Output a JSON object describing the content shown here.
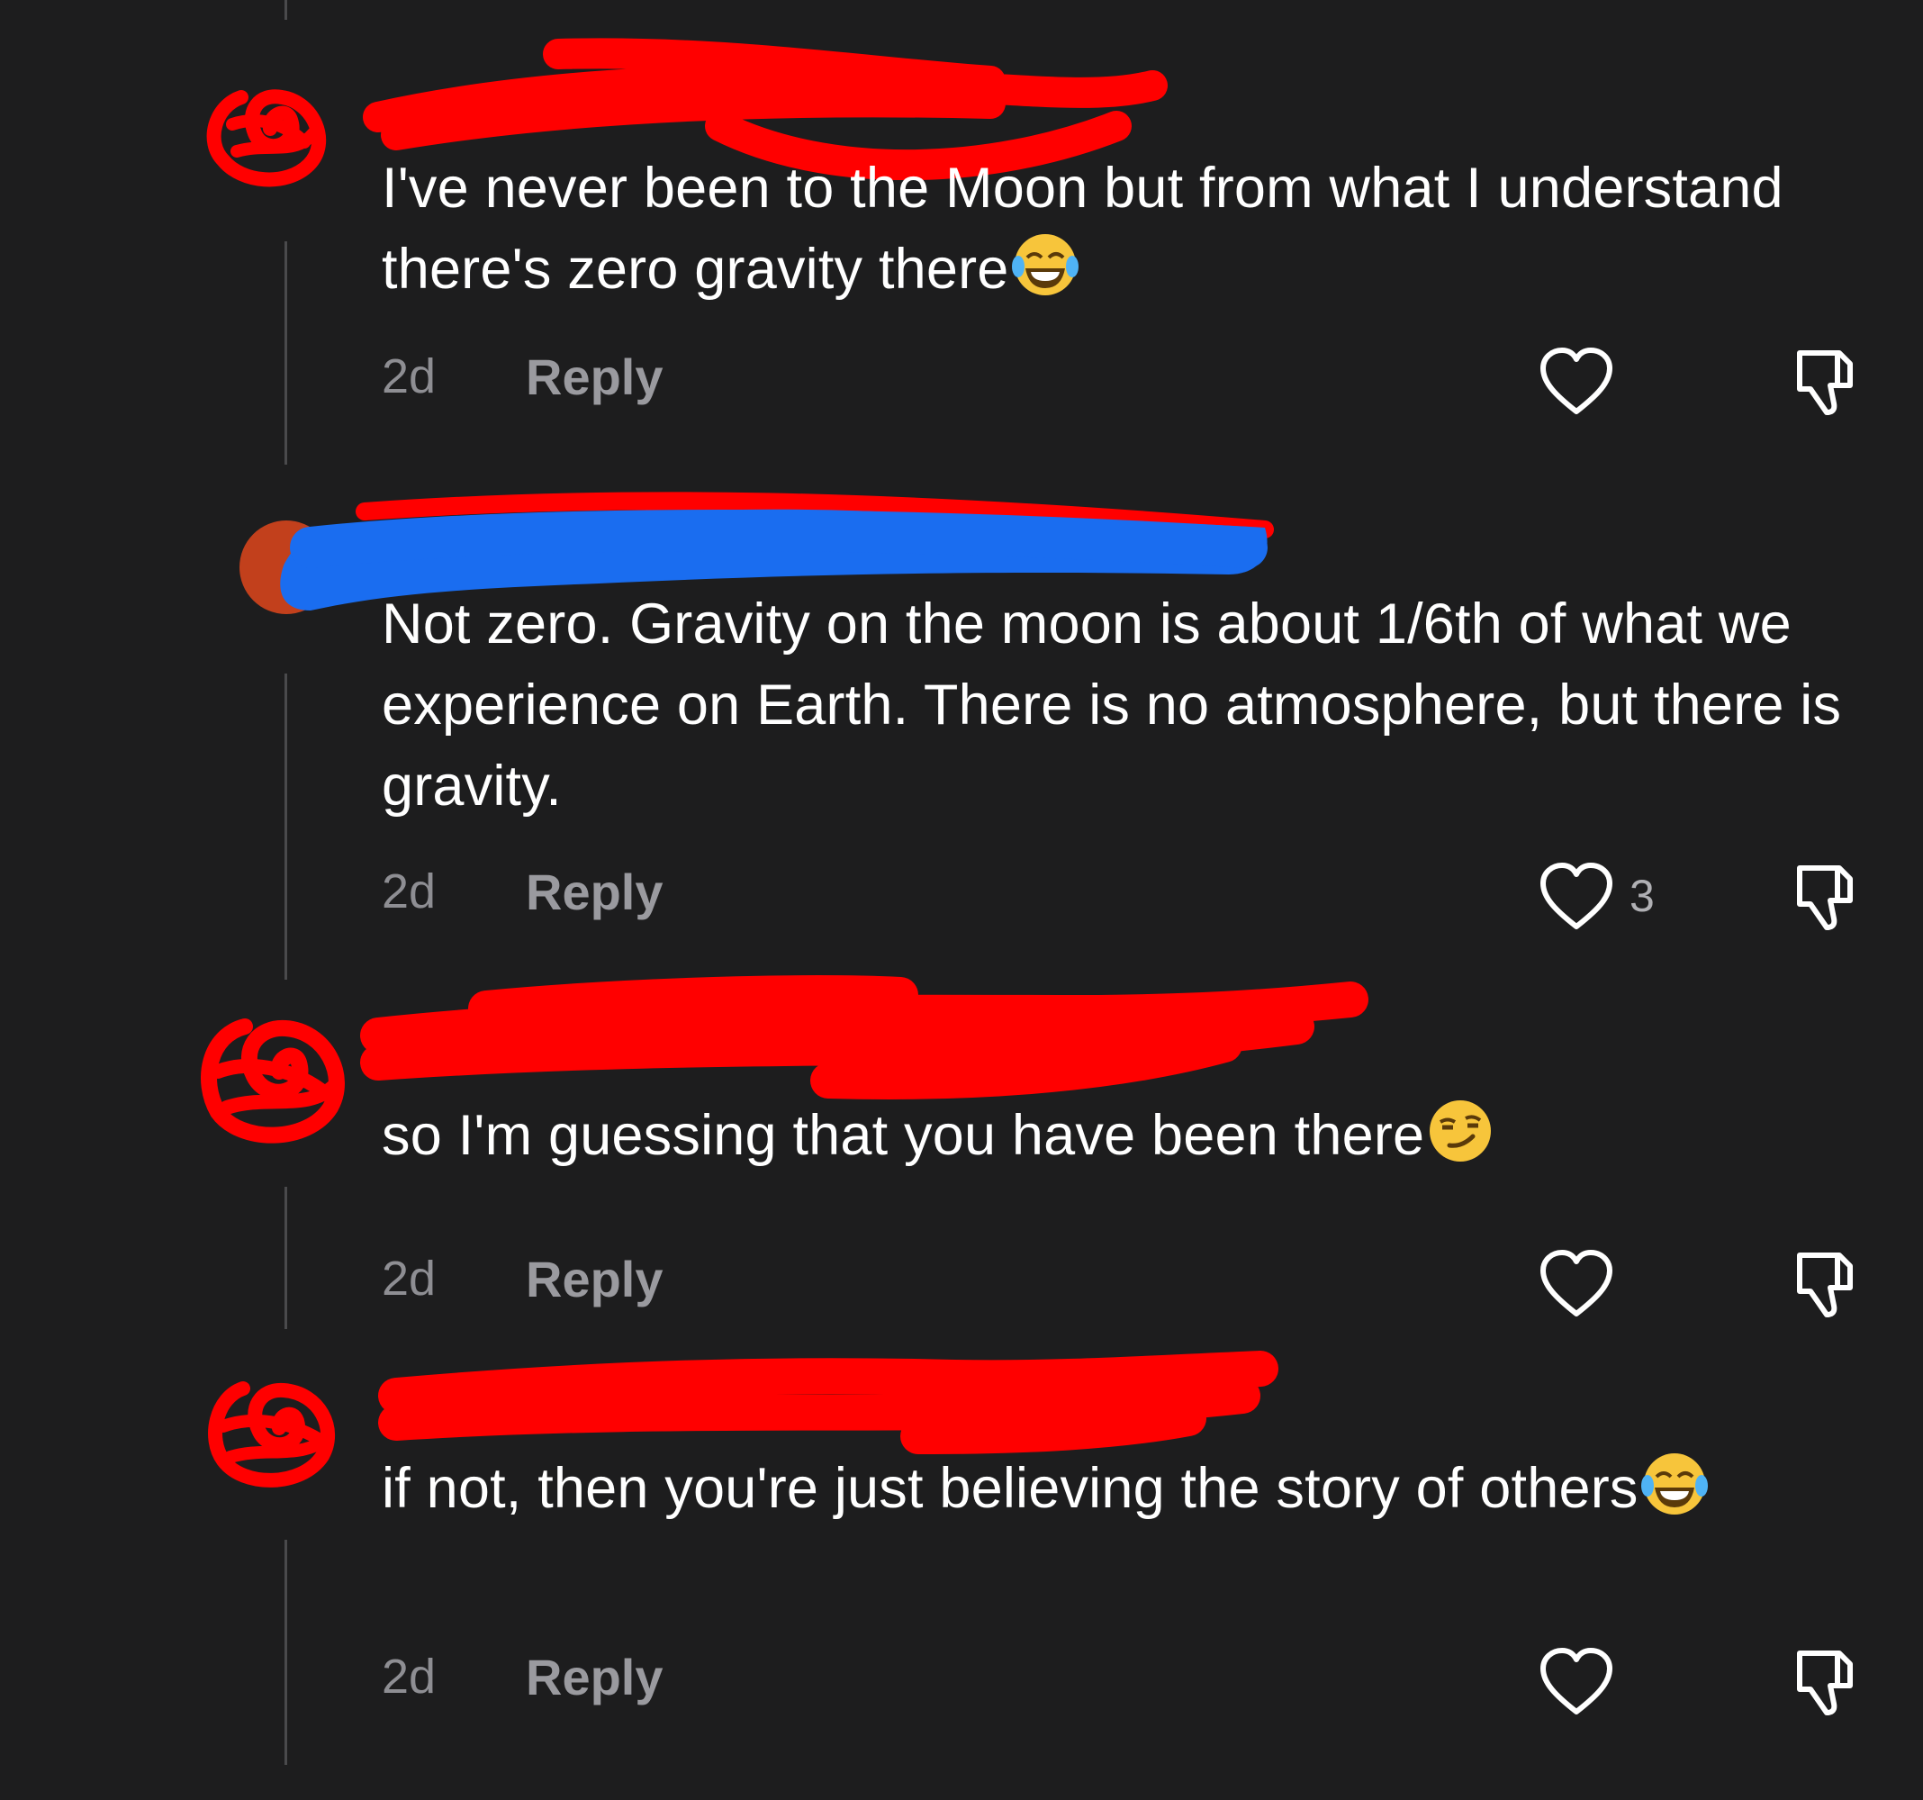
{
  "comments": [
    {
      "text": "I've never been to the Moon but from what I understand there's zero gravity there",
      "emoji": "face-with-tears-of-joy",
      "time": "2d",
      "reply": "Reply",
      "likes": ""
    },
    {
      "text": "Not zero. Gravity on the moon is about 1/6th of what we experience on Earth. There is no atmosphere, but there is gravity.",
      "emoji": "",
      "time": "2d",
      "reply": "Reply",
      "likes": "3"
    },
    {
      "text": "so I'm guessing that you have been there",
      "emoji": "smirking-face",
      "time": "2d",
      "reply": "Reply",
      "likes": ""
    },
    {
      "text": "if not, then you're just believing the story of others",
      "emoji": "face-with-tears-of-joy",
      "time": "2d",
      "reply": "Reply",
      "likes": ""
    }
  ],
  "colors": {
    "background": "#1d1d1e",
    "redaction_red": "#ff0000",
    "redaction_blue": "#1a6df0",
    "muted_text": "#8e8e93"
  }
}
